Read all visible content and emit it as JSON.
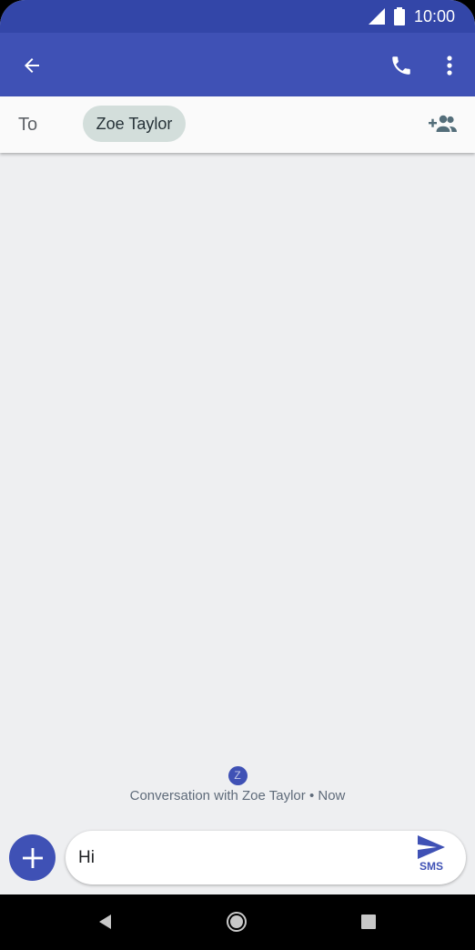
{
  "status_bar": {
    "time": "10:00",
    "icons": [
      "signal-icon",
      "battery-icon"
    ]
  },
  "app_bar": {
    "icons": [
      "back-arrow-icon",
      "phone-icon",
      "more-vert-icon"
    ]
  },
  "recipient": {
    "to_label": "To",
    "chip_name": "Zoe Taylor",
    "add_icon": "add-people-icon"
  },
  "conversation": {
    "avatar_letter": "Z",
    "info_text": "Conversation with Zoe Taylor • Now"
  },
  "composer": {
    "message_value": "Hi",
    "send_label": "SMS",
    "attach_icon": "plus-icon",
    "send_icon": "send-icon"
  },
  "nav_bar": {
    "icons": [
      "nav-back-icon",
      "nav-home-icon",
      "nav-recents-icon"
    ]
  },
  "colors": {
    "primary": "#3f51b5",
    "primary_dark": "#3346a8",
    "background": "#eeeff1",
    "chip": "#d3dedb"
  }
}
